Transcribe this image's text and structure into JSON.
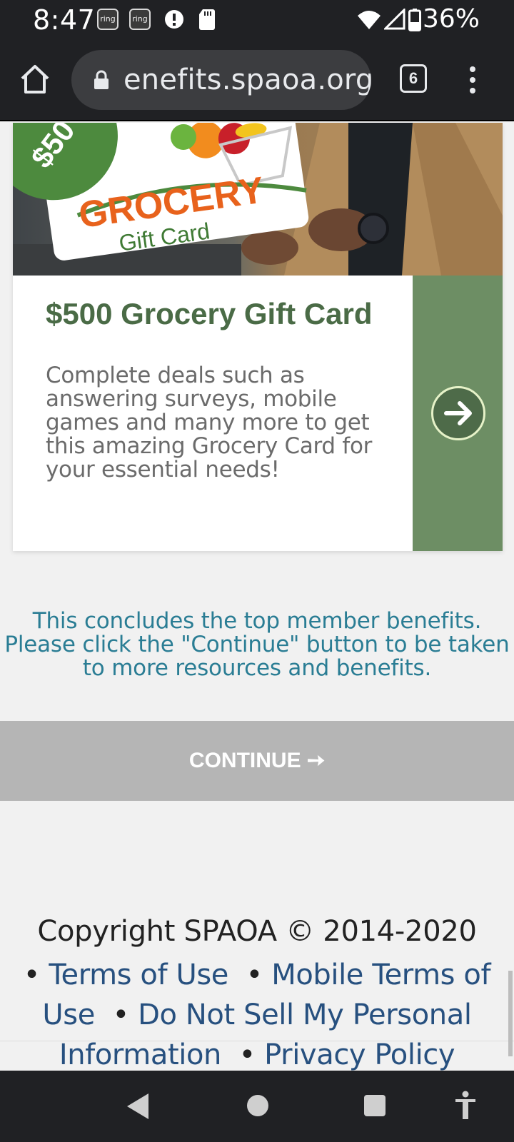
{
  "status_bar": {
    "time": "8:47",
    "notification_icons": [
      "ring",
      "ring"
    ],
    "battery": "36%"
  },
  "browser": {
    "url": "enefits.spaoa.org",
    "tab_count": "6"
  },
  "card": {
    "image_badge": "$50",
    "image_title": "GROCERY",
    "image_subtitle": "Gift Card",
    "title": "$500 Grocery Gift Card",
    "description": "Complete deals such as answering surveys, mobile games and many more to get this amazing Grocery Card for your essential needs!",
    "accent_color": "#6d8e64"
  },
  "conclusion_text": "This concludes the top member benefits. Please click the \"Continue\" button to be taken to more resources and benefits.",
  "continue_button": {
    "label": "CONTINUE ➙"
  },
  "footer": {
    "copyright": "Copyright SPAOA © 2014-2020",
    "bullet": "•",
    "links": {
      "terms": "Terms of Use",
      "mobile_terms": "Mobile Terms of Use",
      "do_not_sell": "Do Not Sell My Personal Information",
      "privacy": "Privacy Policy"
    }
  }
}
